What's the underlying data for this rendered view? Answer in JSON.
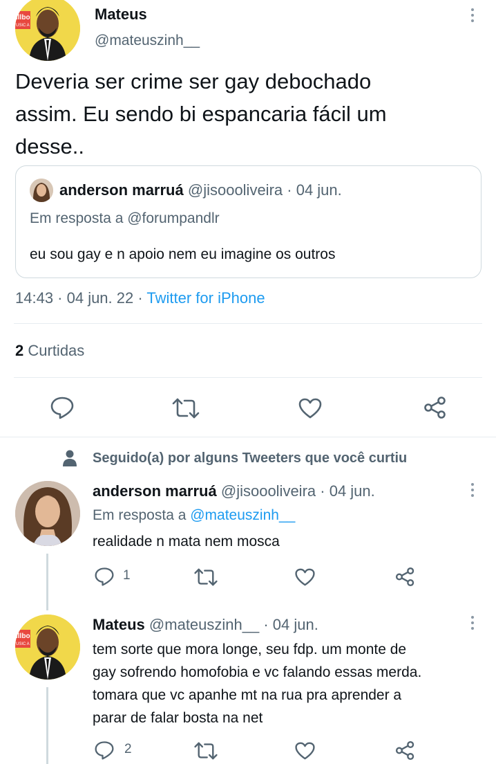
{
  "main_tweet": {
    "author_name": "Mateus",
    "author_handle": "@mateuszinh__",
    "text_lines": [
      "Deveria ser crime ser gay debochado",
      "assim. Eu sendo bi espancaria fácil um",
      "desse.."
    ],
    "quote": {
      "author_name": "anderson marruá",
      "author_handle": "@jisoooliveira",
      "date": "· 04 jun.",
      "reply_to": "Em resposta a @forumpandlr",
      "text": "eu sou gay e n apoio nem eu imagine os outros"
    },
    "meta_time": "14:43 · 04 jun. 22 · ",
    "meta_source": "Twitter for iPhone",
    "likes_count": "2",
    "likes_label": "Curtidas"
  },
  "social_context": "Seguido(a) por alguns Tweeters que você curtiu",
  "replies": [
    {
      "author_name": "anderson marruá",
      "author_handle": "@jisoooliveira",
      "date": "· 04 jun.",
      "reply_prefix": "Em resposta a ",
      "reply_handle": "@mateuszinh__",
      "text_lines": [
        "realidade n mata nem mosca"
      ],
      "reply_count": "1"
    },
    {
      "author_name": "Mateus",
      "author_handle": "@mateuszinh__",
      "date": "· 04 jun.",
      "text_lines": [
        "tem sorte que mora longe, seu fdp. um monte de",
        "gay sofrendo homofobia e vc falando essas merda.",
        "tomara que vc apanhe mt na rua pra aprender a",
        "parar de falar bosta na net"
      ],
      "reply_count": "2"
    }
  ],
  "avatar_badge_text": "illbo\nUSIC A",
  "icons": {
    "reply": "reply-icon",
    "retweet": "retweet-icon",
    "like": "like-icon",
    "share": "share-icon",
    "more": "more-options-icon",
    "person": "person-icon"
  },
  "colors": {
    "accent": "#1d9bf0",
    "secondary_text": "#536471",
    "divider": "#e6ecf0"
  }
}
